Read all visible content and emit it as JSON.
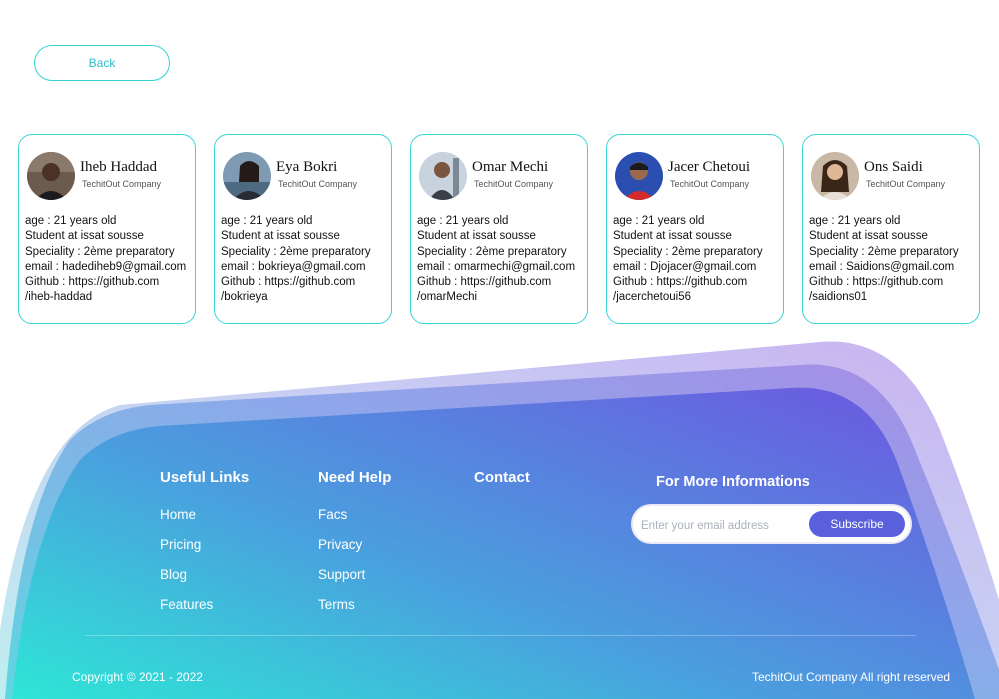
{
  "back_label": "Back",
  "cards": [
    {
      "name": "Iheb Haddad",
      "company": "TechitOut Company",
      "age": "age : 21 years old",
      "school": "Student at issat sousse",
      "speciality": "Speciality : 2ème preparatory",
      "email": "email : hadediheb9@gmail.com",
      "github1": "Github : https://github.com",
      "github2": "/iheb-haddad",
      "avatar_icon": "person-photo-dark-shirt"
    },
    {
      "name": "Eya Bokri",
      "company": "TechitOut Company",
      "age": "age : 21 years old",
      "school": "Student at issat sousse",
      "speciality": "Speciality : 2ème preparatory",
      "email": "email : bokrieya@gmail.com",
      "github1": "Github : https://github.com",
      "github2": "/bokrieya",
      "avatar_icon": "person-photo-seaside"
    },
    {
      "name": "Omar Mechi",
      "company": "TechitOut Company",
      "age": "age : 21 years old",
      "school": "Student at issat sousse",
      "speciality": "Speciality : 2ème preparatory",
      "email": "email : omarmechi@gmail.com",
      "github1": "Github : https://github.com",
      "github2": "/omarMechi",
      "avatar_icon": "person-photo-city"
    },
    {
      "name": "Jacer Chetoui",
      "company": "TechitOut Company",
      "age": "age : 21 years old",
      "school": "Student at issat sousse",
      "speciality": "Speciality : 2ème preparatory",
      "email": "email : Djojacer@gmail.com",
      "github1": "Github : https://github.com",
      "github2": "/jacerchetoui56",
      "avatar_icon": "person-photo-red-shirt"
    },
    {
      "name": "Ons Saidi",
      "company": "TechitOut Company",
      "age": "age : 21 years old",
      "school": "Student at issat sousse",
      "speciality": "Speciality : 2ème preparatory",
      "email": "email : Saidions@gmail.com",
      "github1": "Github : https://github.com",
      "github2": "/saidions01",
      "avatar_icon": "person-photo-long-hair"
    }
  ],
  "footer": {
    "useful_links": {
      "title": "Useful Links",
      "items": [
        "Home",
        "Pricing",
        "Blog",
        "Features"
      ]
    },
    "need_help": {
      "title": "Need Help",
      "items": [
        "Facs",
        "Privacy",
        "Support",
        "Terms"
      ]
    },
    "contact": {
      "title": "Contact"
    },
    "newsletter": {
      "title": "For More Informations",
      "placeholder": "Enter your email address",
      "button": "Subscribe"
    },
    "copyright": "Copyright © 2021 - 2022",
    "rights": "TechitOut Company All right reserved"
  },
  "colors": {
    "accent_border": "#38d6d6",
    "gradient_start": "#2ee6d6",
    "gradient_end": "#6a5ce0",
    "subscribe_bg": "#5a5fdb"
  }
}
